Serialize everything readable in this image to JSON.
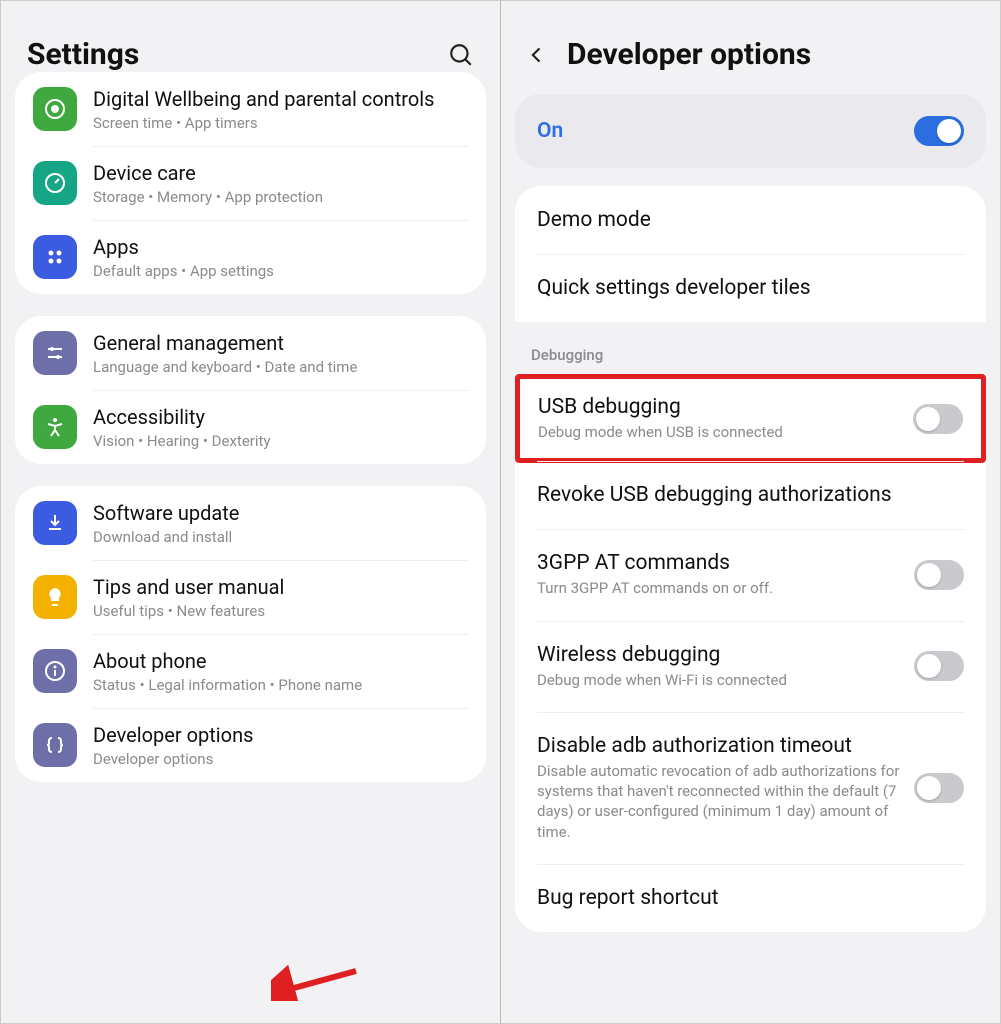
{
  "left": {
    "title": "Settings",
    "groups": [
      {
        "items": [
          {
            "icon": "heart-icon",
            "color": "#3fa83e",
            "title": "Digital Wellbeing and parental controls",
            "sub": "Screen time  •  App timers"
          },
          {
            "icon": "gauge-icon",
            "color": "#17a685",
            "title": "Device care",
            "sub": "Storage  •  Memory  •  App protection"
          },
          {
            "icon": "apps-icon",
            "color": "#3b5be0",
            "title": "Apps",
            "sub": "Default apps  •  App settings"
          }
        ]
      },
      {
        "items": [
          {
            "icon": "sliders-icon",
            "color": "#6e6ea8",
            "title": "General management",
            "sub": "Language and keyboard  •  Date and time"
          },
          {
            "icon": "accessibility-icon",
            "color": "#3fa83e",
            "title": "Accessibility",
            "sub": "Vision  •  Hearing  •  Dexterity"
          }
        ]
      },
      {
        "items": [
          {
            "icon": "download-icon",
            "color": "#3b5be0",
            "title": "Software update",
            "sub": "Download and install"
          },
          {
            "icon": "bulb-icon",
            "color": "#f5b100",
            "title": "Tips and user manual",
            "sub": "Useful tips  •  New features"
          },
          {
            "icon": "info-icon",
            "color": "#6e6ea8",
            "title": "About phone",
            "sub": "Status  •  Legal information  •  Phone name"
          },
          {
            "icon": "braces-icon",
            "color": "#6e6ea8",
            "title": "Developer options",
            "sub": "Developer options"
          }
        ]
      }
    ]
  },
  "right": {
    "title": "Developer options",
    "master_label": "On",
    "master_on": true,
    "section1": [
      {
        "title": "Demo mode"
      },
      {
        "title": "Quick settings developer tiles"
      }
    ],
    "debug_label": "Debugging",
    "usb": {
      "title": "USB debugging",
      "sub": "Debug mode when USB is connected",
      "on": false
    },
    "debug_rest": [
      {
        "title": "Revoke USB debugging authorizations",
        "sub": "",
        "toggle": null
      },
      {
        "title": "3GPP AT commands",
        "sub": "Turn 3GPP AT commands on or off.",
        "toggle": false
      },
      {
        "title": "Wireless debugging",
        "sub": "Debug mode when Wi-Fi is connected",
        "toggle": false
      },
      {
        "title": "Disable adb authorization timeout",
        "sub": "Disable automatic revocation of adb authorizations for systems that haven't reconnected within the default (7 days) or user-configured (minimum 1 day) amount of time.",
        "toggle": false
      },
      {
        "title": "Bug report shortcut",
        "sub": "",
        "toggle": null
      }
    ]
  }
}
